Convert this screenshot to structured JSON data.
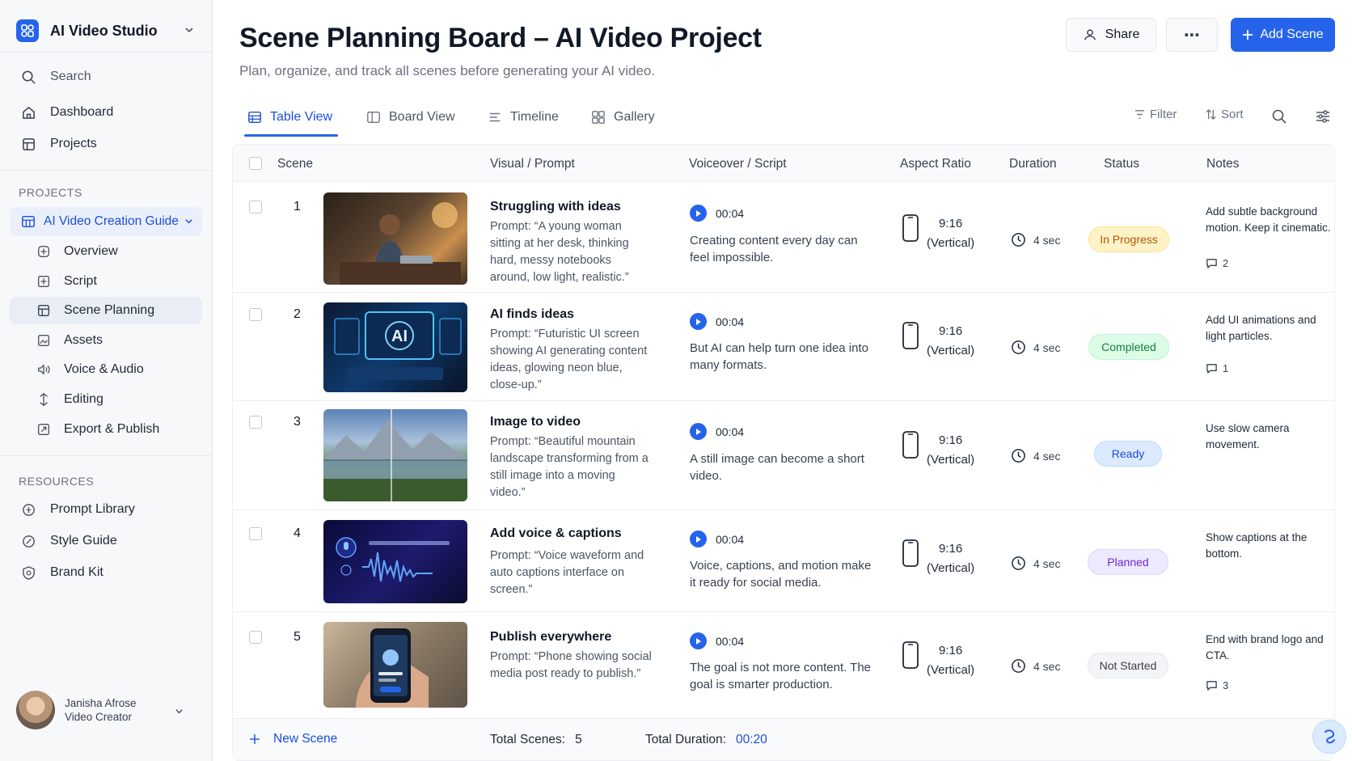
{
  "app": {
    "name": "AI Video Studio"
  },
  "sidebar": {
    "search_label": "Search",
    "main_items": [
      {
        "label": "Dashboard",
        "icon": "home-icon"
      },
      {
        "label": "Projects",
        "icon": "projects-icon"
      }
    ],
    "projects_heading": "PROJECTS",
    "active_project": "AI Video Creation Guide",
    "project_items": [
      {
        "label": "Overview",
        "icon": "overview-icon"
      },
      {
        "label": "Script",
        "icon": "script-icon"
      },
      {
        "label": "Scene Planning",
        "icon": "scene-planning-icon",
        "active": true
      },
      {
        "label": "Assets",
        "icon": "assets-icon"
      },
      {
        "label": "Voice & Audio",
        "icon": "voice-audio-icon"
      },
      {
        "label": "Editing",
        "icon": "editing-icon"
      },
      {
        "label": "Export & Publish",
        "icon": "export-icon"
      }
    ],
    "resources_heading": "RESOURCES",
    "resource_items": [
      {
        "label": "Prompt Library",
        "icon": "prompt-library-icon"
      },
      {
        "label": "Style Guide",
        "icon": "style-guide-icon"
      },
      {
        "label": "Brand Kit",
        "icon": "brand-kit-icon"
      }
    ],
    "user": {
      "name": "Janisha Afrose",
      "role": "Video Creator"
    }
  },
  "header": {
    "title": "Scene Planning Board – AI Video Project",
    "subtitle": "Plan, organize, and track all scenes before generating your AI video.",
    "share_label": "Share",
    "more_label": "⋯",
    "add_scene_label": "Add Scene"
  },
  "tabs": [
    {
      "label": "Table View",
      "icon": "table-icon",
      "active": true
    },
    {
      "label": "Board View",
      "icon": "board-icon"
    },
    {
      "label": "Timeline",
      "icon": "timeline-icon"
    },
    {
      "label": "Gallery",
      "icon": "gallery-icon"
    }
  ],
  "toolbar": {
    "filter_label": "Filter",
    "sort_label": "Sort"
  },
  "table": {
    "columns": [
      "Scene",
      "Visual / Prompt",
      "Voiceover / Script",
      "Aspect Ratio",
      "Duration",
      "Status",
      "Notes"
    ],
    "rows": [
      {
        "num": "1",
        "title": "Struggling with ideas",
        "prompt": "Prompt: “A young woman sitting at her desk, thinking hard, messy notebooks around, low light, realistic.”",
        "vo_time": "00:04",
        "vo_text": "Creating content every day can feel impossible.",
        "ar_ratio": "9:16",
        "ar_label": "(Vertical)",
        "duration": "4 sec",
        "status": "In Progress",
        "note": "Add subtle background motion. Keep it cinematic.",
        "comments": "2"
      },
      {
        "num": "2",
        "title": "AI finds ideas",
        "prompt": "Prompt: “Futuristic UI screen showing AI generating content ideas, glowing neon blue, close-up.”",
        "vo_time": "00:04",
        "vo_text": "But AI can help turn one idea into many formats.",
        "ar_ratio": "9:16",
        "ar_label": "(Vertical)",
        "duration": "4 sec",
        "status": "Completed",
        "note": "Add UI animations and light particles.",
        "comments": "1",
        "thumb_text": "AI"
      },
      {
        "num": "3",
        "title": "Image to video",
        "prompt": "Prompt: “Beautiful mountain landscape transforming from a still image into a moving video.”",
        "vo_time": "00:04",
        "vo_text": "A still image can become a short video.",
        "ar_ratio": "9:16",
        "ar_label": "(Vertical)",
        "duration": "4 sec",
        "status": "Ready",
        "note": "Use slow camera movement.",
        "comments": ""
      },
      {
        "num": "4",
        "title": "Add voice & captions",
        "prompt": "Prompt: “Voice waveform and auto captions interface on screen.”",
        "vo_time": "00:04",
        "vo_text": "Voice, captions, and motion make it ready for social media.",
        "ar_ratio": "9:16",
        "ar_label": "(Vertical)",
        "duration": "4 sec",
        "status": "Planned",
        "note": "Show captions at the bottom.",
        "comments": ""
      },
      {
        "num": "5",
        "title": "Publish everywhere",
        "prompt": "Prompt: “Phone showing social media post ready to publish.”",
        "vo_time": "00:04",
        "vo_text": "The goal is not more content. The goal is smarter production.",
        "ar_ratio": "9:16",
        "ar_label": "(Vertical)",
        "duration": "4 sec",
        "status": "Not Started",
        "note": "End with brand logo and CTA.",
        "comments": "3"
      }
    ],
    "footer": {
      "new_scene_label": "New Scene",
      "total_scenes_label": "Total Scenes:",
      "total_scenes_value": "5",
      "total_duration_label": "Total Duration:",
      "total_duration_value": "00:20"
    }
  },
  "colors": {
    "accent": "#2563eb",
    "status_in_progress": "#fef3c7",
    "status_completed": "#dcfce7",
    "status_ready": "#dbeafe",
    "status_planned": "#ede9fe",
    "status_not_started": "#f3f4f6"
  }
}
